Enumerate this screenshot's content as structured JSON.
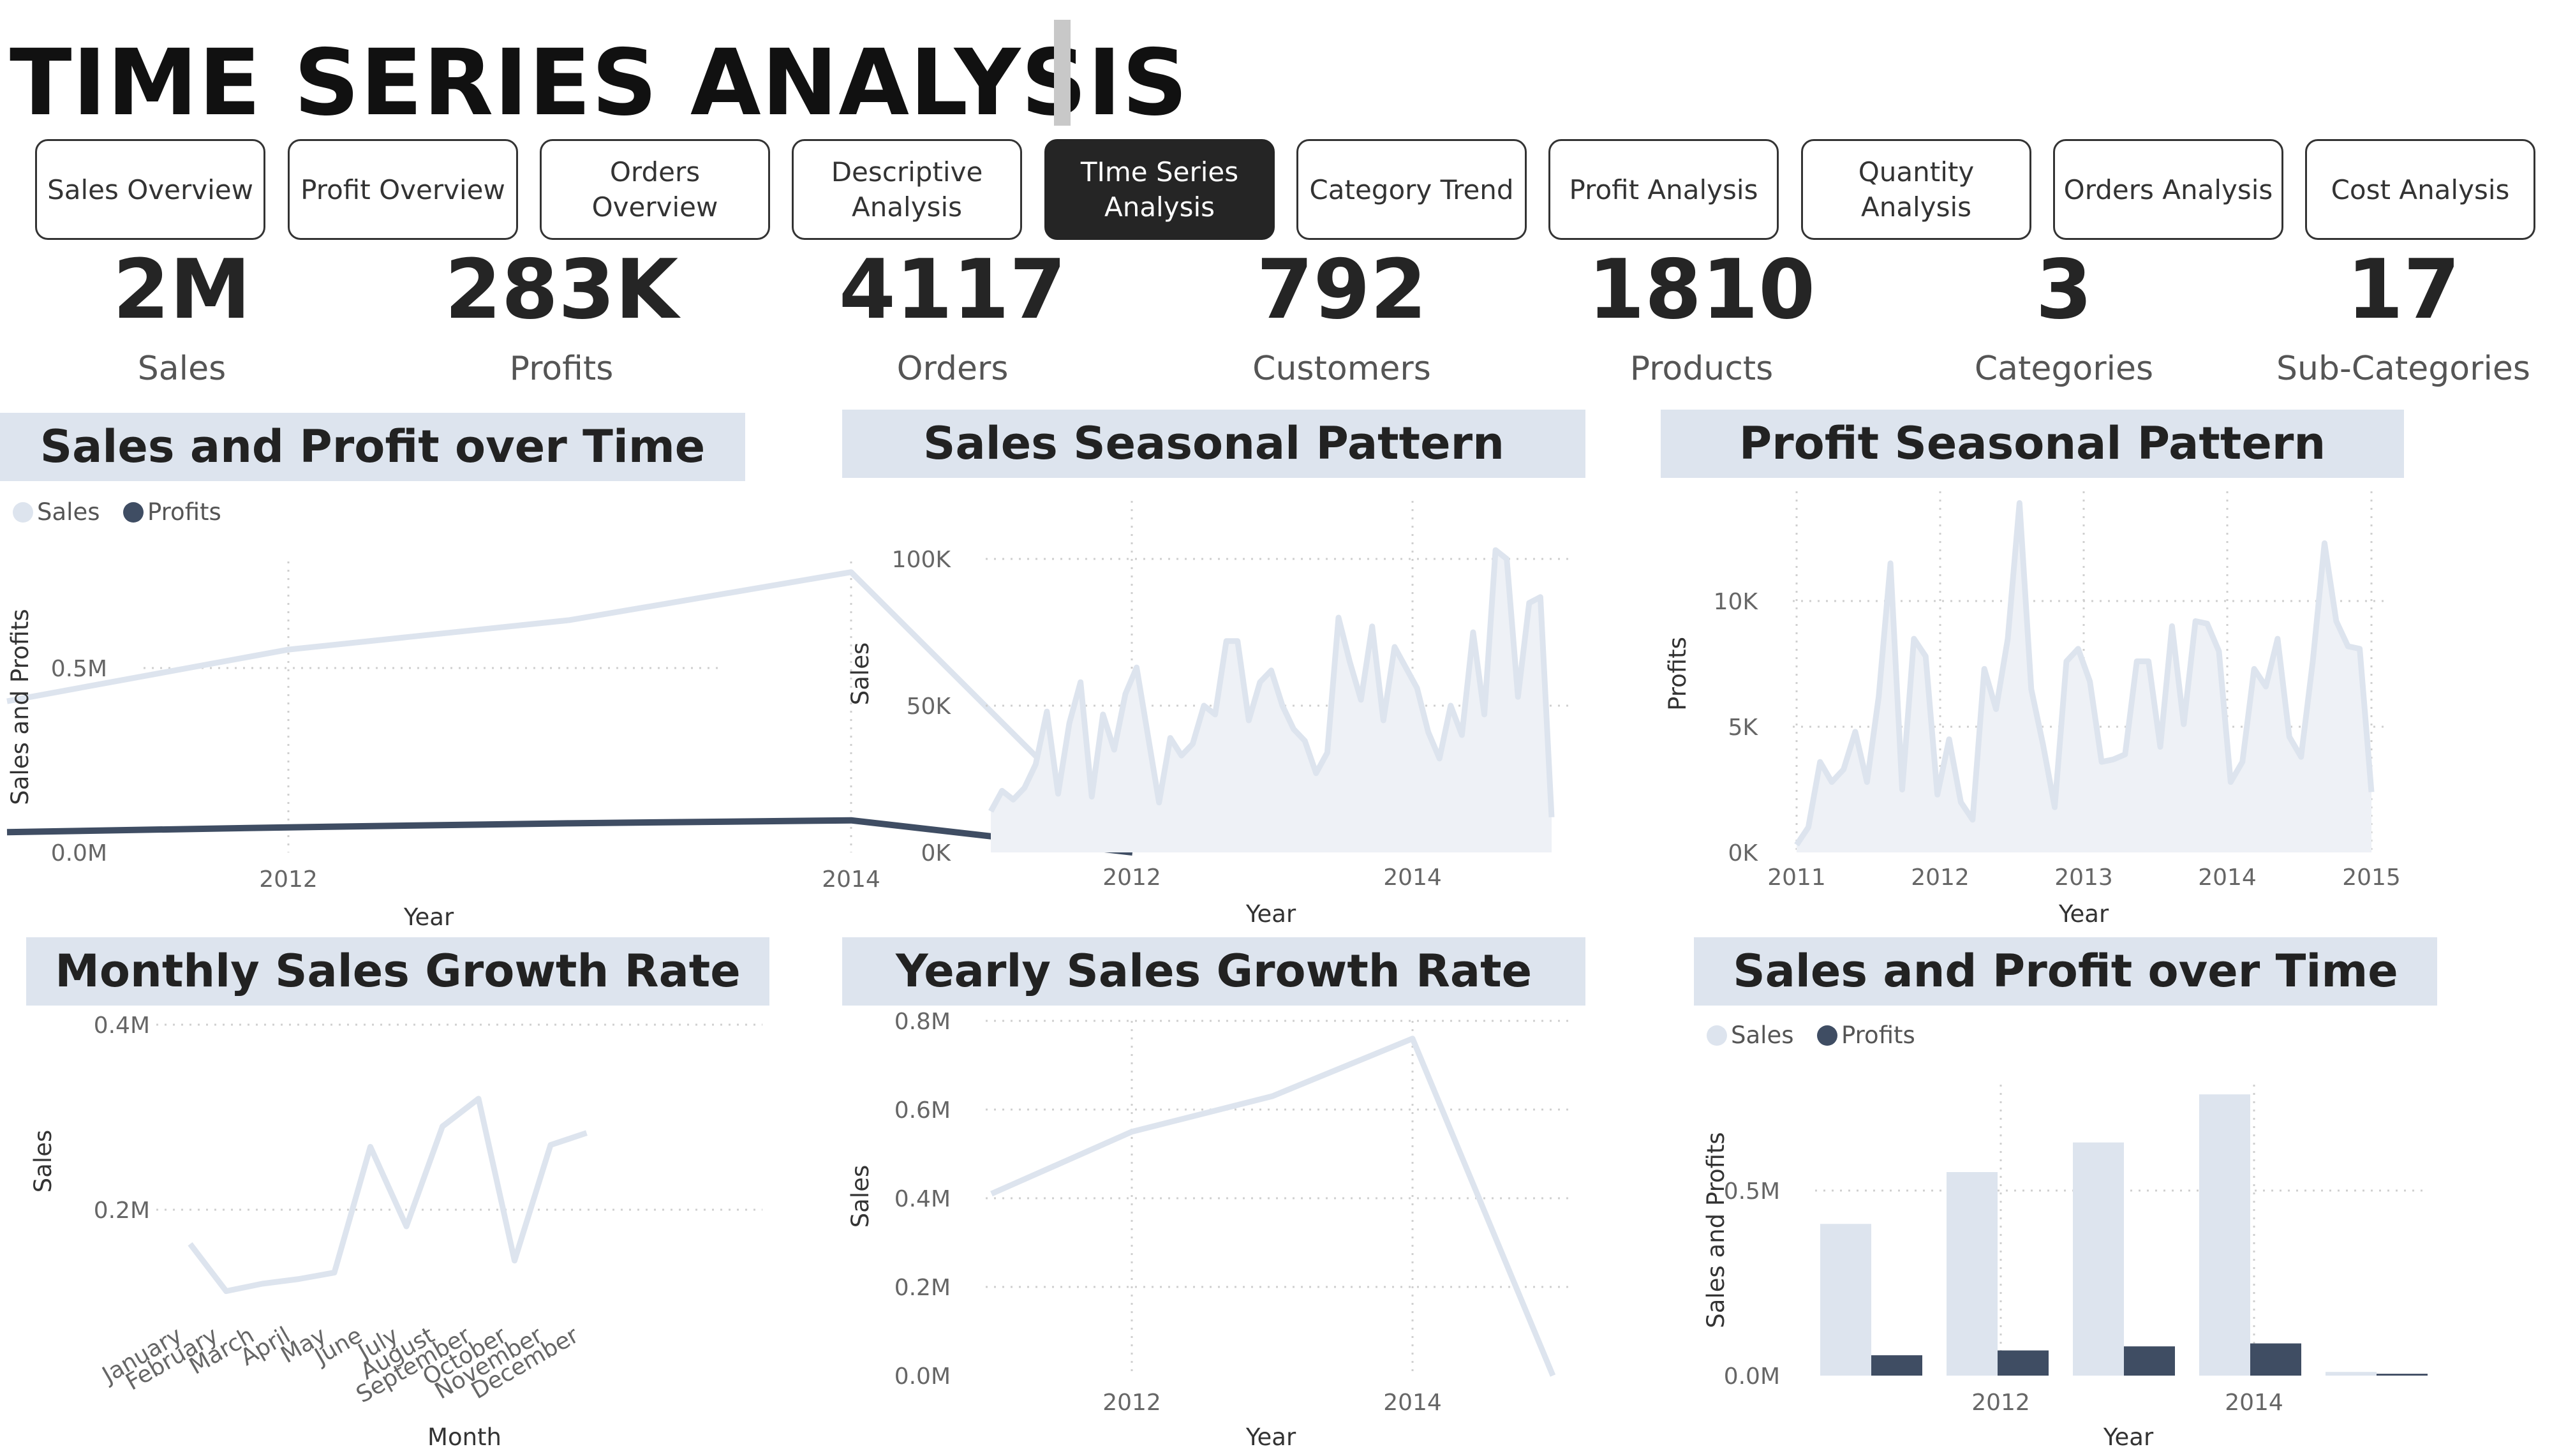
{
  "header": {
    "title": "TIME SERIES ANALYSIS"
  },
  "nav": [
    {
      "label": "Sales Overview",
      "active": false
    },
    {
      "label": "Profit Overview",
      "active": false
    },
    {
      "label": "Orders Overview",
      "active": false
    },
    {
      "label": "Descriptive Analysis",
      "active": false
    },
    {
      "label": "TIme Series Analysis",
      "active": true
    },
    {
      "label": "Category Trend",
      "active": false
    },
    {
      "label": "Profit Analysis",
      "active": false
    },
    {
      "label": "Quantity Analysis",
      "active": false
    },
    {
      "label": "Orders Analysis",
      "active": false
    },
    {
      "label": "Cost Analysis",
      "active": false
    }
  ],
  "kpis": [
    {
      "value": "2M",
      "label": "Sales"
    },
    {
      "value": "283K",
      "label": "Profits"
    },
    {
      "value": "4117",
      "label": "Orders"
    },
    {
      "value": "792",
      "label": "Customers"
    },
    {
      "value": "1810",
      "label": "Products"
    },
    {
      "value": "3",
      "label": "Categories"
    },
    {
      "value": "17",
      "label": "Sub-Categories"
    }
  ],
  "colors": {
    "sales": "#dde4ee",
    "profits": "#3f4d63",
    "panel_bg": "#dde4ee",
    "active_nav": "#252525"
  },
  "chart_data": [
    {
      "id": "c1",
      "type": "line",
      "title": "Sales and Profit over Time",
      "xlabel": "Year",
      "ylabel": "Sales and Profits",
      "legend": [
        "Sales",
        "Profits"
      ],
      "legend_position": "top-left",
      "x": [
        2011,
        2012,
        2013,
        2014,
        2015
      ],
      "series": [
        {
          "name": "Sales",
          "values": [
            410000,
            550000,
            630000,
            760000,
            0
          ]
        },
        {
          "name": "Profits",
          "values": [
            55000,
            68000,
            79000,
            87000,
            0
          ]
        }
      ],
      "xticks": [
        "2012",
        "2014"
      ],
      "yticks": [
        "0.0M",
        "0.5M"
      ],
      "ylim": [
        0,
        800000
      ],
      "grid": true
    },
    {
      "id": "c2",
      "type": "area",
      "title": "Sales Seasonal Pattern",
      "xlabel": "Year",
      "ylabel": "Sales",
      "x_start": "2011-01",
      "x_end": "2015-01",
      "values": [
        14000,
        21000,
        18000,
        22000,
        30000,
        48000,
        20000,
        44000,
        58000,
        19000,
        47000,
        35000,
        54000,
        63000,
        40000,
        17000,
        39000,
        33000,
        37000,
        50000,
        47000,
        72000,
        72000,
        45000,
        58000,
        62000,
        50000,
        42000,
        38000,
        27000,
        34000,
        80000,
        65000,
        52000,
        77000,
        45000,
        70000,
        63000,
        56000,
        41000,
        32000,
        50000,
        40000,
        75000,
        47000,
        103000,
        100000,
        53000,
        85000,
        87000,
        12000
      ],
      "xticks": [
        "2012",
        "2014"
      ],
      "yticks": [
        "0K",
        "50K",
        "100K"
      ],
      "ylim": [
        0,
        110000
      ],
      "grid": true
    },
    {
      "id": "c3",
      "type": "area",
      "title": "Profit Seasonal Pattern",
      "xlabel": "Year",
      "ylabel": "Profits",
      "x_start": "2011-01",
      "x_end": "2015-01",
      "values": [
        300,
        1000,
        3600,
        2800,
        3300,
        4800,
        2800,
        6200,
        11500,
        2500,
        8500,
        7800,
        2300,
        4500,
        2000,
        1300,
        7300,
        5700,
        8500,
        13900,
        6500,
        4300,
        1800,
        7600,
        8100,
        6800,
        3600,
        3700,
        3900,
        7600,
        7600,
        4200,
        9000,
        5100,
        9200,
        9100,
        8000,
        2800,
        3600,
        7300,
        6600,
        8500,
        4600,
        3800,
        7600,
        12300,
        9200,
        8200,
        8100,
        2400
      ],
      "xticks": [
        "2011",
        "2012",
        "2013",
        "2014",
        "2015"
      ],
      "yticks": [
        "0K",
        "5K",
        "10K"
      ],
      "ylim": [
        0,
        14500
      ],
      "grid": true
    },
    {
      "id": "c4",
      "type": "line",
      "title": "Monthly Sales Growth Rate",
      "xlabel": "Month",
      "ylabel": "Sales",
      "categories": [
        "January",
        "February",
        "March",
        "April",
        "May",
        "June",
        "July",
        "August",
        "September",
        "October",
        "November",
        "December"
      ],
      "values": [
        163000,
        112000,
        120000,
        125000,
        132000,
        268000,
        182000,
        290000,
        320000,
        145000,
        270000,
        283000
      ],
      "yticks": [
        "0.2M",
        "0.4M"
      ],
      "ylim": [
        0,
        420000
      ],
      "grid": true
    },
    {
      "id": "c5",
      "type": "line",
      "title": "Yearly Sales Growth Rate",
      "xlabel": "Year",
      "ylabel": "Sales",
      "x": [
        2011,
        2012,
        2013,
        2014,
        2015
      ],
      "values": [
        410000,
        550000,
        630000,
        760000,
        0
      ],
      "xticks": [
        "2012",
        "2014"
      ],
      "yticks": [
        "0.0M",
        "0.2M",
        "0.4M",
        "0.6M",
        "0.8M"
      ],
      "ylim": [
        0,
        800000
      ],
      "grid": true
    },
    {
      "id": "c6",
      "type": "bar",
      "title": "Sales and Profit over Time",
      "xlabel": "Year",
      "ylabel": "Sales and Profits",
      "legend": [
        "Sales",
        "Profits"
      ],
      "legend_position": "top-left",
      "categories": [
        "2011",
        "2012",
        "2013",
        "2014",
        "2015"
      ],
      "series": [
        {
          "name": "Sales",
          "values": [
            410000,
            550000,
            630000,
            760000,
            10000
          ]
        },
        {
          "name": "Profits",
          "values": [
            55000,
            68000,
            79000,
            87000,
            5000
          ]
        }
      ],
      "xticks": [
        "2012",
        "2014"
      ],
      "yticks": [
        "0.0M",
        "0.5M"
      ],
      "ylim": [
        0,
        800000
      ],
      "grid": true
    }
  ]
}
